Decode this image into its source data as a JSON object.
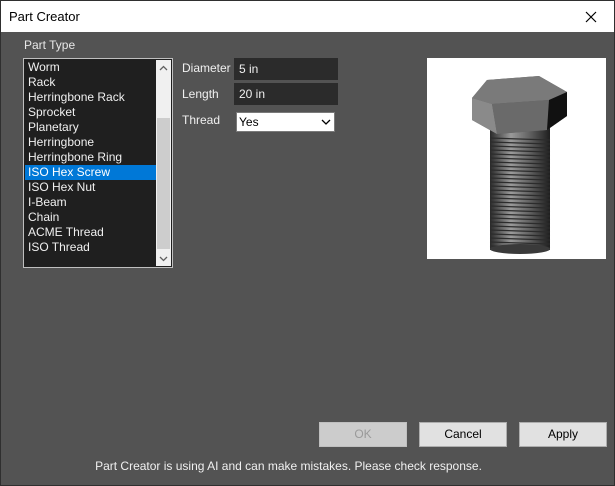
{
  "window": {
    "title": "Part Creator"
  },
  "part_type": {
    "label": "Part Type",
    "items": [
      "Worm",
      "Rack",
      "Herringbone Rack",
      "Sprocket",
      "Planetary",
      "Herringbone",
      "Herringbone Ring",
      "ISO Hex Screw",
      "ISO Hex Nut",
      "I-Beam",
      "Chain",
      "ACME Thread",
      "ISO Thread"
    ],
    "selected": "ISO Hex Screw"
  },
  "params": {
    "diameter_label": "Diameter",
    "diameter_value": "5 in",
    "length_label": "Length",
    "length_value": "20 in",
    "thread_label": "Thread",
    "thread_value": "Yes"
  },
  "buttons": {
    "ok": "OK",
    "cancel": "Cancel",
    "apply": "Apply"
  },
  "disclaimer": "Part Creator is using AI and can make mistakes. Please check response.",
  "icons": {
    "close": "close-icon",
    "scroll_up": "chevron-up-icon",
    "scroll_down": "chevron-down-icon",
    "dropdown": "chevron-down-icon"
  },
  "colors": {
    "selection": "#0078d7",
    "background": "#535353"
  }
}
